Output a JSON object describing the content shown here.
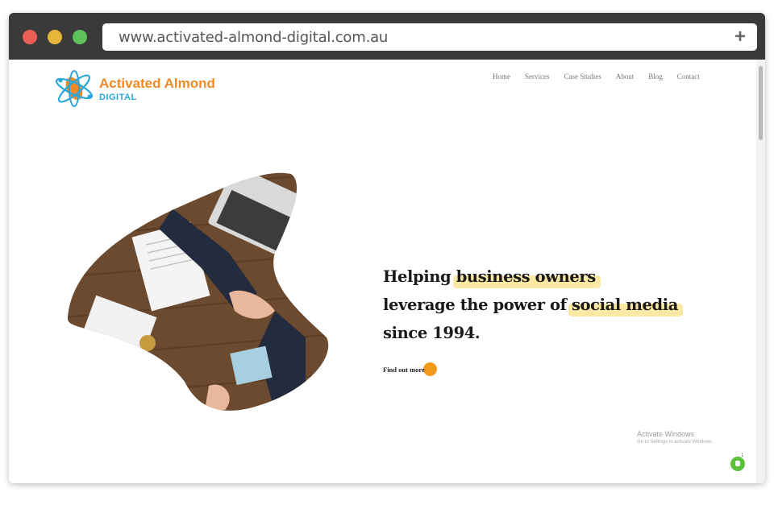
{
  "browser": {
    "url": "www.activated-almond-digital.com.au",
    "new_tab_icon": "plus-icon"
  },
  "site": {
    "logo": {
      "name": "Activated Almond",
      "sub": "DIGITAL",
      "colors": {
        "orange": "#f08a24",
        "blue": "#29a7d8"
      }
    },
    "nav": [
      "Home",
      "Services",
      "Case Studies",
      "About",
      "Blog",
      "Contact"
    ]
  },
  "hero": {
    "line1_pre": "Helping ",
    "line1_hl": "business owners",
    "line2_pre": "leverage the power of ",
    "line2_hl": "social media",
    "line3": "since 1994.",
    "highlight_color": "#fbe59a",
    "cta_label": "Find out more",
    "cta_color": "#f39a1c"
  },
  "overlay": {
    "activate_title": "Activate Windows",
    "activate_sub": "Go to Settings to activate Windows.",
    "chat_badge": "1"
  }
}
